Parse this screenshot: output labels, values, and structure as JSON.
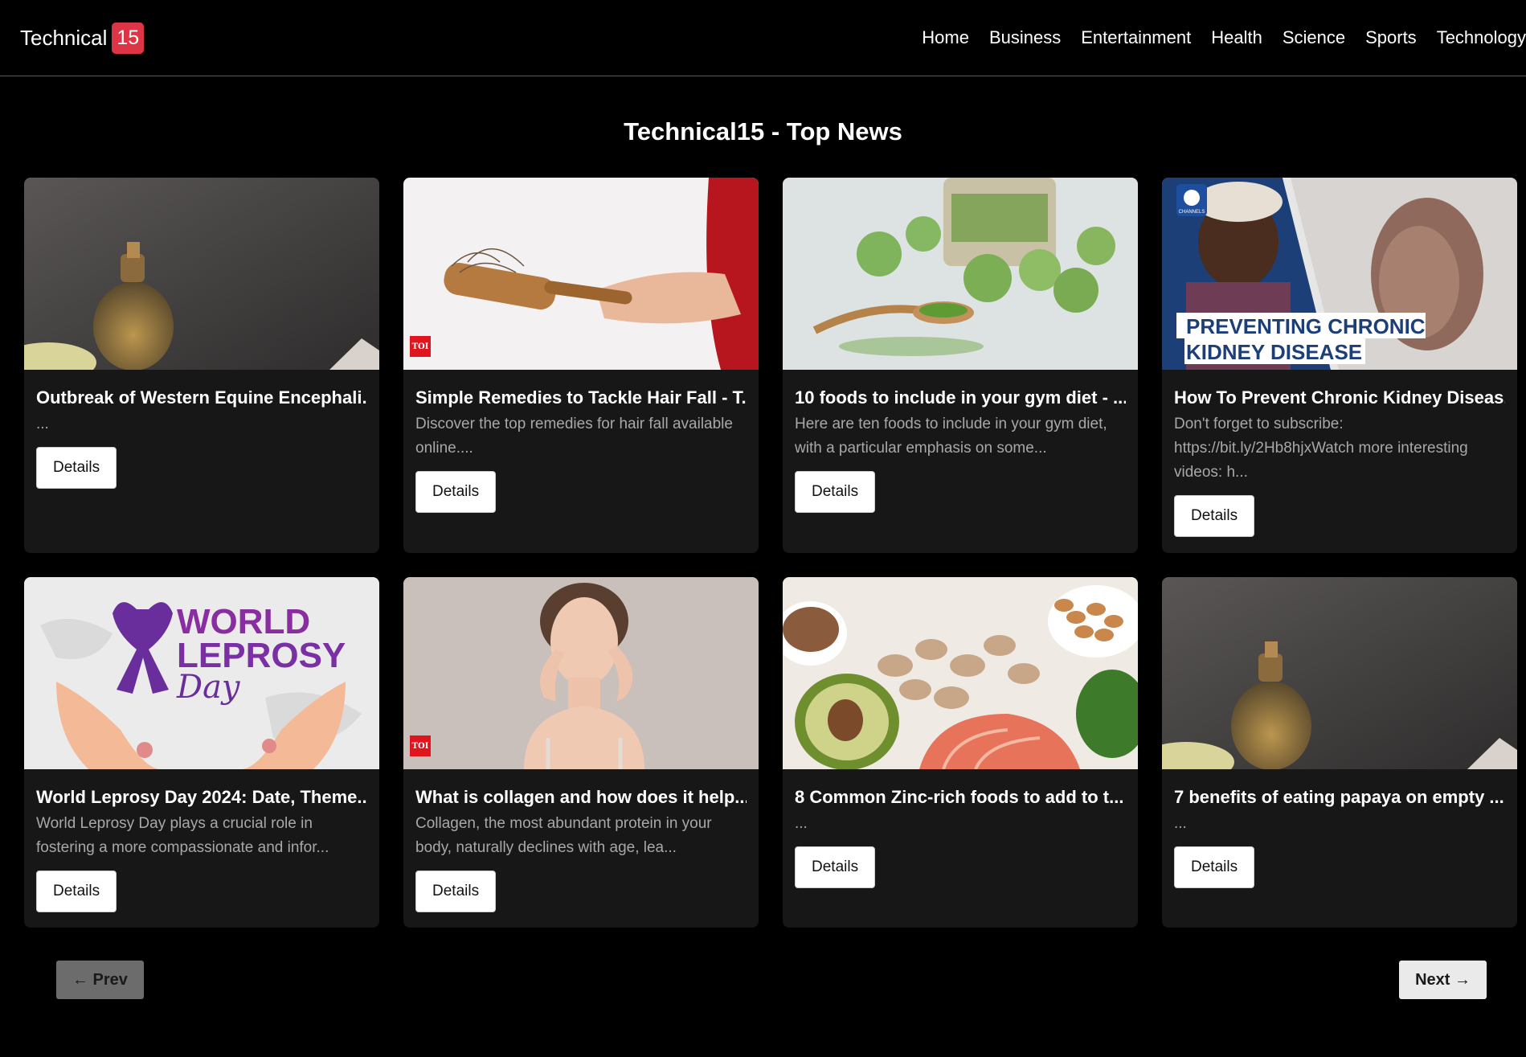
{
  "brand": {
    "name": "Technical",
    "badge": "15"
  },
  "nav": [
    "Home",
    "Business",
    "Entertainment",
    "Health",
    "Science",
    "Sports",
    "Technology"
  ],
  "page_title": "Technical15 - Top News",
  "cards": [
    {
      "title": "Outbreak of Western Equine Encephali...",
      "desc": "...",
      "button": "Details",
      "image": "oil-bottle-blurred"
    },
    {
      "title": "Simple Remedies to Tackle Hair Fall - T...",
      "desc": "Discover the top remedies for hair fall available online....",
      "button": "Details",
      "image": "hairbrush-hair",
      "image_label": "TOI"
    },
    {
      "title": "10 foods to include in your gym diet - ...",
      "desc": "Here are ten foods to include in your gym diet, with a particular emphasis on some...",
      "button": "Details",
      "image": "green-protein-balls"
    },
    {
      "title": "How To Prevent Chronic Kidney Diseas...",
      "desc": "Don't forget to subscribe: https://bit.ly/2Hb8hjxWatch more interesting videos: h...",
      "button": "Details",
      "image": "kidney-disease-broadcast",
      "image_text": [
        "PREVENTING CHRONIC",
        "KIDNEY DISEASE"
      ],
      "image_logo": "CHANNELS"
    },
    {
      "title": "World Leprosy Day 2024: Date, Theme...",
      "desc": "World Leprosy Day plays a crucial role in fostering a more compassionate and infor...",
      "button": "Details",
      "image": "world-leprosy-day",
      "image_text": [
        "WORLD",
        "LEPROSY",
        "Day"
      ]
    },
    {
      "title": "What is collagen and how does it help...",
      "desc": "Collagen, the most abundant protein in your body, naturally declines with age, lea...",
      "button": "Details",
      "image": "woman-skincare",
      "image_label": "TOI"
    },
    {
      "title": "8 Common Zinc-rich foods to add to t...",
      "desc": "...",
      "button": "Details",
      "image": "zinc-foods"
    },
    {
      "title": "7 benefits of eating papaya on empty ...",
      "desc": "...",
      "button": "Details",
      "image": "oil-bottle-blurred"
    }
  ],
  "pager": {
    "prev": "← Prev",
    "next": "Next →"
  },
  "colors": {
    "badge": "#dc3545",
    "card_bg": "#171717",
    "page_bg": "#000000"
  }
}
